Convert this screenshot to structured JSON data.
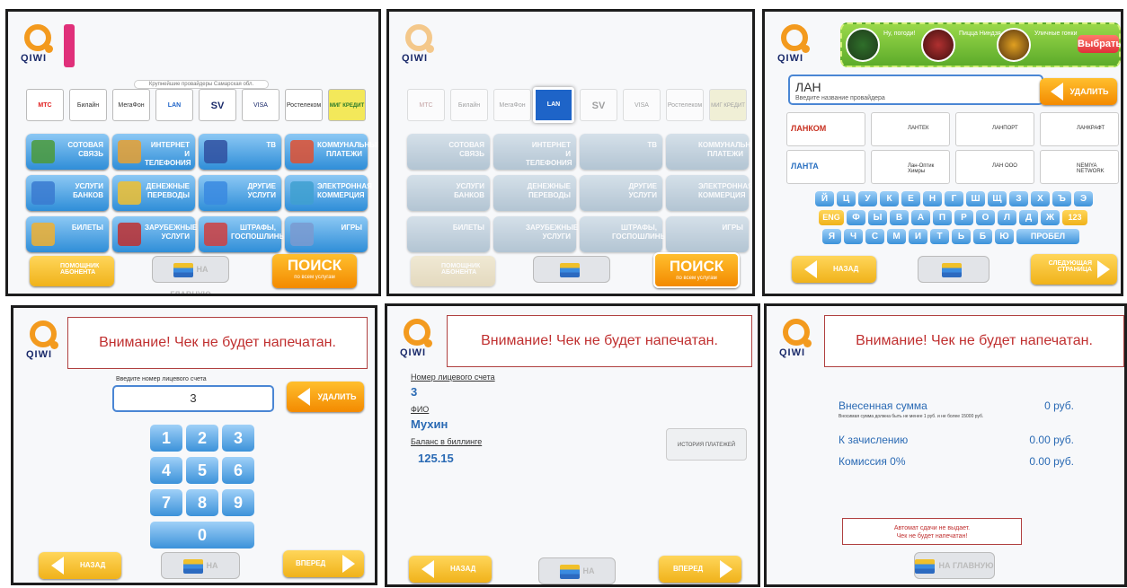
{
  "brand": {
    "logo_text": "QIWI",
    "accent": "#f39a1e",
    "blue": "#2f8ed8"
  },
  "screen1": {
    "caption": "Крупнейшие провайдеры Самарская обл.",
    "providers": [
      "МТС",
      "Билайн",
      "МегаФон",
      "LAN",
      "SV",
      "VISA",
      "Ростелеком",
      "МИГ КРЕДИТ"
    ],
    "categories": [
      "СОТОВАЯ СВЯЗЬ",
      "ИНТЕРНЕТ И ТЕЛЕФОНИЯ",
      "ТВ",
      "КОММУНАЛЬНЫЕ ПЛАТЕЖИ",
      "УСЛУГИ БАНКОВ",
      "ДЕНЕЖНЫЕ ПЕРЕВОДЫ",
      "ДРУГИЕ УСЛУГИ",
      "ЭЛЕКТРОННАЯ КОММЕРЦИЯ",
      "БИЛЕТЫ",
      "ЗАРУБЕЖНЫЕ УСЛУГИ",
      "ШТРАФЫ, ГОСПОШЛИНЫ",
      "ИГРЫ"
    ],
    "help_label": "ПОМОЩНИК АБОНЕНТА",
    "main_label": "НА ГЛАВНУЮ",
    "search_label": "ПОИСК",
    "search_sub": "по всем услугам"
  },
  "screen3": {
    "banner": [
      "Ну, погоди!",
      "Пицца Ниндзя",
      "Уличные гонки"
    ],
    "choose_label": "Выбрать",
    "query": "ЛАН",
    "query_hint": "Введите название провайдера",
    "delete_label": "УДАЛИТЬ",
    "results": [
      "ЛАНКОМ",
      "ЛАНТЕК",
      "ЛАНПОРТ",
      "ЛАНКРАФТ",
      "ЛАНТА",
      "Лан-Оптик Химры",
      "ЛАН ООО",
      "NEMIYA NETWORK"
    ],
    "keys_row1": [
      "Й",
      "Ц",
      "У",
      "К",
      "Е",
      "Н",
      "Г",
      "Ш",
      "Щ",
      "З",
      "Х",
      "Ъ",
      "Э"
    ],
    "keys_row2": [
      "ENG",
      "Ф",
      "Ы",
      "В",
      "А",
      "П",
      "Р",
      "О",
      "Л",
      "Д",
      "Ж",
      "123"
    ],
    "keys_row3": [
      "Я",
      "Ч",
      "С",
      "М",
      "И",
      "Т",
      "Ь",
      "Б",
      "Ю",
      "ПРОБЕЛ"
    ],
    "back_label": "НАЗАД",
    "next_label": "СЛЕДУЮЩАЯ СТРАНИЦА"
  },
  "warning": "Внимание! Чек не будет напечатан.",
  "screen4": {
    "prompt": "Введите номер лицевого счета",
    "value": "3",
    "delete_label": "УДАЛИТЬ",
    "keys": [
      "1",
      "2",
      "3",
      "4",
      "5",
      "6",
      "7",
      "8",
      "9",
      "0"
    ],
    "back_label": "НАЗАД",
    "forward_label": "ВПЕРЕД",
    "main_label": "НА ГЛАВНУЮ"
  },
  "screen5": {
    "account_label": "Номер лицевого счета",
    "account_value": "3",
    "fio_label": "ФИО",
    "fio_value": "Мухин",
    "balance_label": "Баланс в биллинге",
    "balance_value": "125.15",
    "history_label": "ИСТОРИЯ ПЛАТЕЖЕЙ",
    "back_label": "НАЗАД",
    "forward_label": "ВПЕРЕД",
    "main_label": "НА ГЛАВНУЮ"
  },
  "screen6": {
    "deposited_label": "Внесенная сумма",
    "deposited_value": "0 руб.",
    "deposited_note": "Вносимая сумма должна быть не менее 1 руб. и не более 15000 руб.",
    "credit_label": "К зачислению",
    "credit_value": "0.00 руб.",
    "fee_label": "Комиссия 0%",
    "fee_value": "0.00 руб.",
    "notice_1": "Автомат сдачи не выдает.",
    "notice_2": "Чек не будет напечатан!",
    "main_label": "НА ГЛАВНУЮ"
  }
}
